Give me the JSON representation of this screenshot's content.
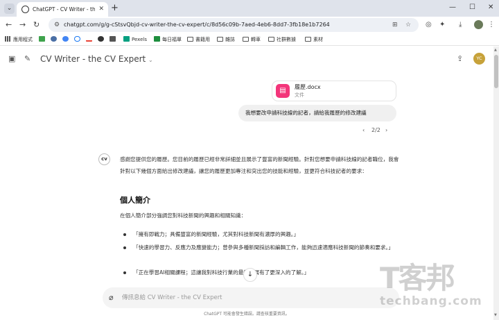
{
  "browser": {
    "tab_title": "ChatGPT - CV Writer - the CV",
    "url": "chatgpt.com/g/g-cStsvQbjd-cv-writer-the-cv-expert/c/8d56c09b-7aed-4eb6-8dd7-3fb18e1b7264",
    "bookmarks": [
      "應用程式",
      "Pexels",
      "每日福單",
      "書籍用",
      "雜誌",
      "轉車",
      "社群數據",
      "素材"
    ]
  },
  "chat": {
    "gpt_name": "CV Writer - the CV Expert",
    "user_initials": "YC",
    "file_name": "履歷.docx",
    "file_type": "文件",
    "user_message": "我想要改申請科技線的記者，請給我履歷的修改建議",
    "pager": "2/2",
    "reply_intro": "感謝您提供您的履歷。您目前的履歷已經非常詳細並且展示了豐富的新聞經驗。針對您想要申請科技線的記者職位，我會針對以下幾個方面給出修改建議，讓您的履歷更加專注和突出您的技能和經驗，並更符合科技記者的要求：",
    "section_title": "個人簡介",
    "section_desc": "在個人簡介部分強調您對科技新聞的興趣和相關知識：",
    "bullets": [
      "「擁有即戰力；具備豐富的新聞經驗，尤其對科技新聞有濃厚的興趣。」",
      "「快速的學習力、反應力及應變能力；曾參與多種新聞採訪和編輯工作，能夠迅速適應科技新聞的節奏和要求。」",
      "「正在學習AI相關課程；這讓我對科技行業的最新發展有了更深入的了解。」"
    ],
    "composer_placeholder": "傳訊息給 CV Writer - the CV Expert",
    "disclaimer": "ChatGPT 可能會發生錯誤。請查核重要資訊。"
  },
  "watermark": {
    "cn": "T客邦",
    "en": "techbang.com"
  },
  "icons": {
    "favicon": "chatgpt-logo-icon",
    "file": "document-icon",
    "attach": "paperclip-icon",
    "scroll": "arrow-down-icon"
  },
  "colors": {
    "file_icon": "#f3357a",
    "avatar": "#c7a23a"
  }
}
